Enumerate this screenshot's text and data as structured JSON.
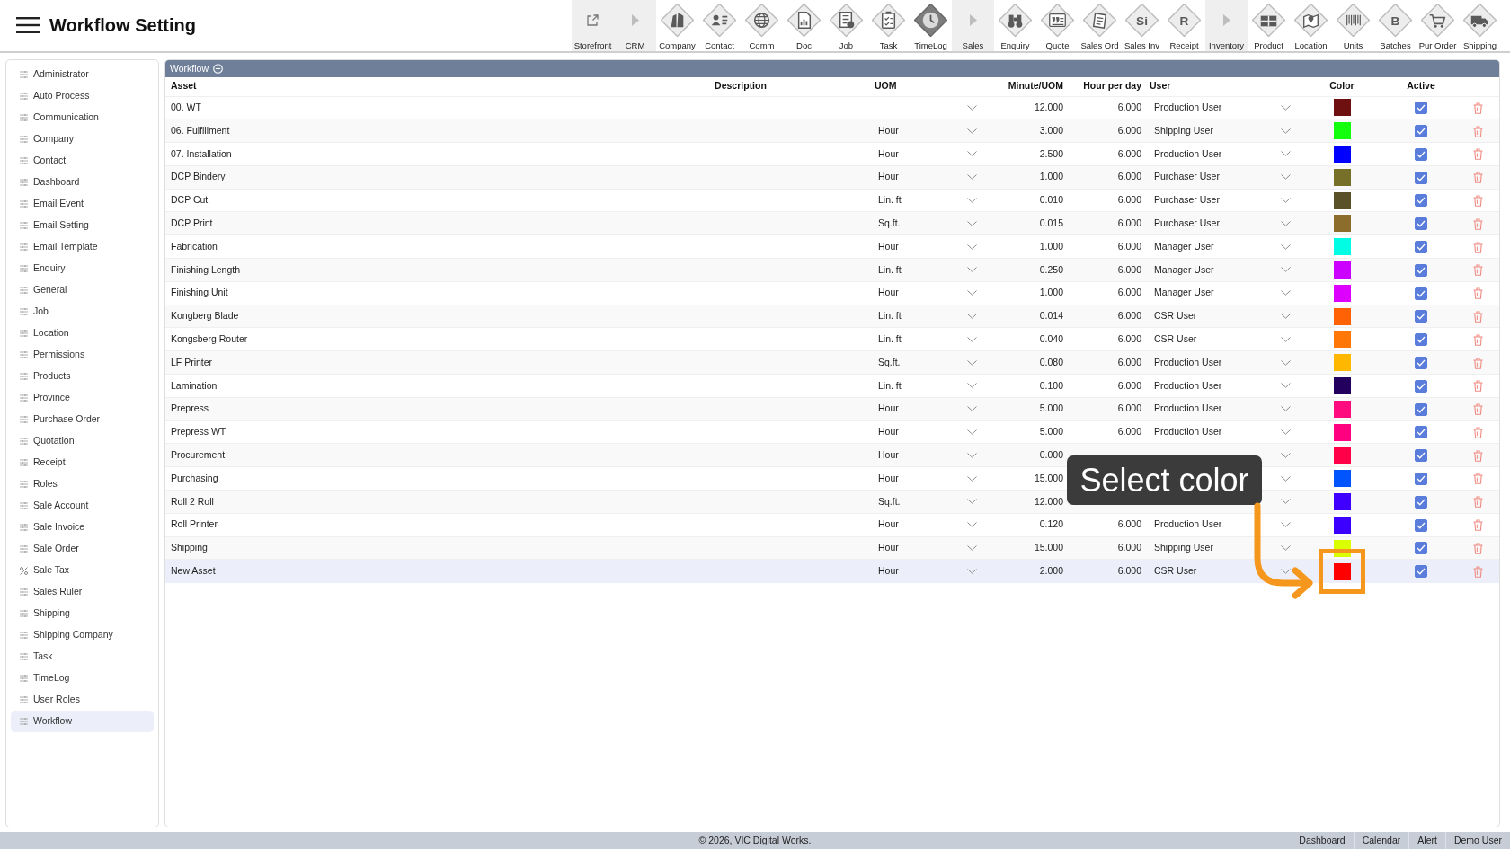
{
  "header": {
    "title": "Workflow Setting",
    "toolbar": [
      {
        "label": "Storefront",
        "kind": "link"
      },
      {
        "label": "CRM",
        "kind": "group"
      },
      {
        "label": "Company",
        "kind": "module"
      },
      {
        "label": "Contact",
        "kind": "module"
      },
      {
        "label": "Comm",
        "kind": "module"
      },
      {
        "label": "Doc",
        "kind": "module"
      },
      {
        "label": "Job",
        "kind": "module"
      },
      {
        "label": "Task",
        "kind": "module"
      },
      {
        "label": "TimeLog",
        "kind": "module"
      },
      {
        "label": "Sales",
        "kind": "group"
      },
      {
        "label": "Enquiry",
        "kind": "module"
      },
      {
        "label": "Quote",
        "kind": "module"
      },
      {
        "label": "Sales Ord",
        "kind": "module"
      },
      {
        "label": "Sales Inv",
        "kind": "module",
        "glyph": "Si"
      },
      {
        "label": "Receipt",
        "kind": "module",
        "glyph": "R"
      },
      {
        "label": "Inventory",
        "kind": "group"
      },
      {
        "label": "Product",
        "kind": "module"
      },
      {
        "label": "Location",
        "kind": "module"
      },
      {
        "label": "Units",
        "kind": "module"
      },
      {
        "label": "Batches",
        "kind": "module",
        "glyph": "B"
      },
      {
        "label": "Pur Order",
        "kind": "module"
      },
      {
        "label": "Shipping",
        "kind": "module"
      }
    ]
  },
  "sidebar": {
    "items": [
      {
        "label": "Administrator",
        "kind": "setting",
        "selected": false
      },
      {
        "label": "Auto Process",
        "kind": "setting",
        "selected": false
      },
      {
        "label": "Communication",
        "kind": "setting",
        "selected": false
      },
      {
        "label": "Company",
        "kind": "setting",
        "selected": false
      },
      {
        "label": "Contact",
        "kind": "setting",
        "selected": false
      },
      {
        "label": "Dashboard",
        "kind": "setting",
        "selected": false
      },
      {
        "label": "Email Event",
        "kind": "setting",
        "selected": false
      },
      {
        "label": "Email Setting",
        "kind": "setting",
        "selected": false
      },
      {
        "label": "Email Template",
        "kind": "setting",
        "selected": false
      },
      {
        "label": "Enquiry",
        "kind": "setting",
        "selected": false
      },
      {
        "label": "General",
        "kind": "setting",
        "selected": false
      },
      {
        "label": "Job",
        "kind": "setting",
        "selected": false
      },
      {
        "label": "Location",
        "kind": "setting",
        "selected": false
      },
      {
        "label": "Permissions",
        "kind": "setting",
        "selected": false
      },
      {
        "label": "Products",
        "kind": "setting",
        "selected": false
      },
      {
        "label": "Province",
        "kind": "setting",
        "selected": false
      },
      {
        "label": "Purchase Order",
        "kind": "setting",
        "selected": false
      },
      {
        "label": "Quotation",
        "kind": "setting",
        "selected": false
      },
      {
        "label": "Receipt",
        "kind": "setting",
        "selected": false
      },
      {
        "label": "Roles",
        "kind": "setting",
        "selected": false
      },
      {
        "label": "Sale Account",
        "kind": "setting",
        "selected": false
      },
      {
        "label": "Sale Invoice",
        "kind": "setting",
        "selected": false
      },
      {
        "label": "Sale Order",
        "kind": "setting",
        "selected": false
      },
      {
        "label": "Sale Tax",
        "kind": "tax",
        "selected": false
      },
      {
        "label": "Sales Ruler",
        "kind": "setting",
        "selected": false
      },
      {
        "label": "Shipping",
        "kind": "setting",
        "selected": false
      },
      {
        "label": "Shipping Company",
        "kind": "setting",
        "selected": false
      },
      {
        "label": "Task",
        "kind": "setting",
        "selected": false
      },
      {
        "label": "TimeLog",
        "kind": "setting",
        "selected": false
      },
      {
        "label": "User Roles",
        "kind": "setting",
        "selected": false
      },
      {
        "label": "Workflow",
        "kind": "setting",
        "selected": true
      }
    ]
  },
  "panel": {
    "title": "Workflow",
    "table": {
      "columns": [
        "Asset",
        "Description",
        "UOM",
        "Minute/UOM",
        "Hour per day",
        "User",
        "Color",
        "Active"
      ],
      "rows": [
        {
          "asset": "00. WT",
          "minute": "12.000",
          "hours": "6.000",
          "user": "Production User",
          "color": "#6e1010",
          "active": true,
          "selected": false
        },
        {
          "asset": "06. Fulfillment",
          "uom": "Hour",
          "minute": "3.000",
          "hours": "6.000",
          "user": "Shipping User",
          "color": "#14ff0e",
          "active": true,
          "selected": false
        },
        {
          "asset": "07. Installation",
          "uom": "Hour",
          "minute": "2.500",
          "hours": "6.000",
          "user": "Production User",
          "color": "#0000ff",
          "active": true,
          "selected": false
        },
        {
          "asset": "DCP Bindery",
          "uom": "Hour",
          "minute": "1.000",
          "hours": "6.000",
          "user": "Purchaser User",
          "color": "#767028",
          "active": true,
          "selected": false
        },
        {
          "asset": "DCP Cut",
          "uom": "Lin. ft",
          "minute": "0.010",
          "hours": "6.000",
          "user": "Purchaser User",
          "color": "#5a5128",
          "active": true,
          "selected": false
        },
        {
          "asset": "DCP Print",
          "uom": "Sq.ft.",
          "minute": "0.015",
          "hours": "6.000",
          "user": "Purchaser User",
          "color": "#8c6d2c",
          "active": true,
          "selected": false
        },
        {
          "asset": "Fabrication",
          "uom": "Hour",
          "minute": "1.000",
          "hours": "6.000",
          "user": "Manager User",
          "color": "#00fde4",
          "active": true,
          "selected": false
        },
        {
          "asset": "Finishing Length",
          "uom": "Lin. ft",
          "minute": "0.250",
          "hours": "6.000",
          "user": "Manager User",
          "color": "#cc00ff",
          "active": true,
          "selected": false
        },
        {
          "asset": "Finishing Unit",
          "uom": "Hour",
          "minute": "1.000",
          "hours": "6.000",
          "user": "Manager User",
          "color": "#dd00ff",
          "active": true,
          "selected": false
        },
        {
          "asset": "Kongberg Blade",
          "uom": "Lin. ft",
          "minute": "0.014",
          "hours": "6.000",
          "user": "CSR User",
          "color": "#ff6105",
          "active": true,
          "selected": false
        },
        {
          "asset": "Kongsberg Router",
          "uom": "Lin. ft",
          "minute": "0.040",
          "hours": "6.000",
          "user": "CSR User",
          "color": "#ff7706",
          "active": true,
          "selected": false
        },
        {
          "asset": "LF Printer",
          "uom": "Sq.ft.",
          "minute": "0.080",
          "hours": "6.000",
          "user": "Production User",
          "color": "#ffb700",
          "active": true,
          "selected": false
        },
        {
          "asset": "Lamination",
          "uom": "Lin. ft",
          "minute": "0.100",
          "hours": "6.000",
          "user": "Production User",
          "color": "#23005e",
          "active": true,
          "selected": false
        },
        {
          "asset": "Prepress",
          "uom": "Hour",
          "minute": "5.000",
          "hours": "6.000",
          "user": "Production User",
          "color": "#ff0a7f",
          "active": true,
          "selected": false
        },
        {
          "asset": "Prepress WT",
          "uom": "Hour",
          "minute": "5.000",
          "hours": "6.000",
          "user": "Production User",
          "color": "#ff0080",
          "active": true,
          "selected": false
        },
        {
          "asset": "Procurement",
          "uom": "Hour",
          "minute": "0.000",
          "color": "#ff0048",
          "active": true,
          "selected": false
        },
        {
          "asset": "Purchasing",
          "uom": "Hour",
          "minute": "15.000",
          "color": "#0055ff",
          "active": true,
          "selected": false
        },
        {
          "asset": "Roll 2 Roll",
          "uom": "Sq.ft.",
          "minute": "12.000",
          "color": "#4000ff",
          "active": true,
          "selected": false
        },
        {
          "asset": "Roll Printer",
          "uom": "Hour",
          "minute": "0.120",
          "hours": "6.000",
          "user": "Production User",
          "color": "#3b00ff",
          "active": true,
          "selected": false
        },
        {
          "asset": "Shipping",
          "uom": "Hour",
          "minute": "15.000",
          "hours": "6.000",
          "user": "Shipping User",
          "color": "#d9ff00",
          "active": true,
          "selected": false
        },
        {
          "asset": "New Asset",
          "uom": "Hour",
          "minute": "2.000",
          "hours": "6.000",
          "user": "CSR User",
          "color": "#ff0000",
          "active": true,
          "selected": true
        }
      ]
    }
  },
  "callout": {
    "text": "Select color"
  },
  "footer": {
    "copyright": "© 2026, VIC Digital Works.",
    "links": [
      "Dashboard",
      "Calendar",
      "Alert",
      "Demo User"
    ]
  }
}
